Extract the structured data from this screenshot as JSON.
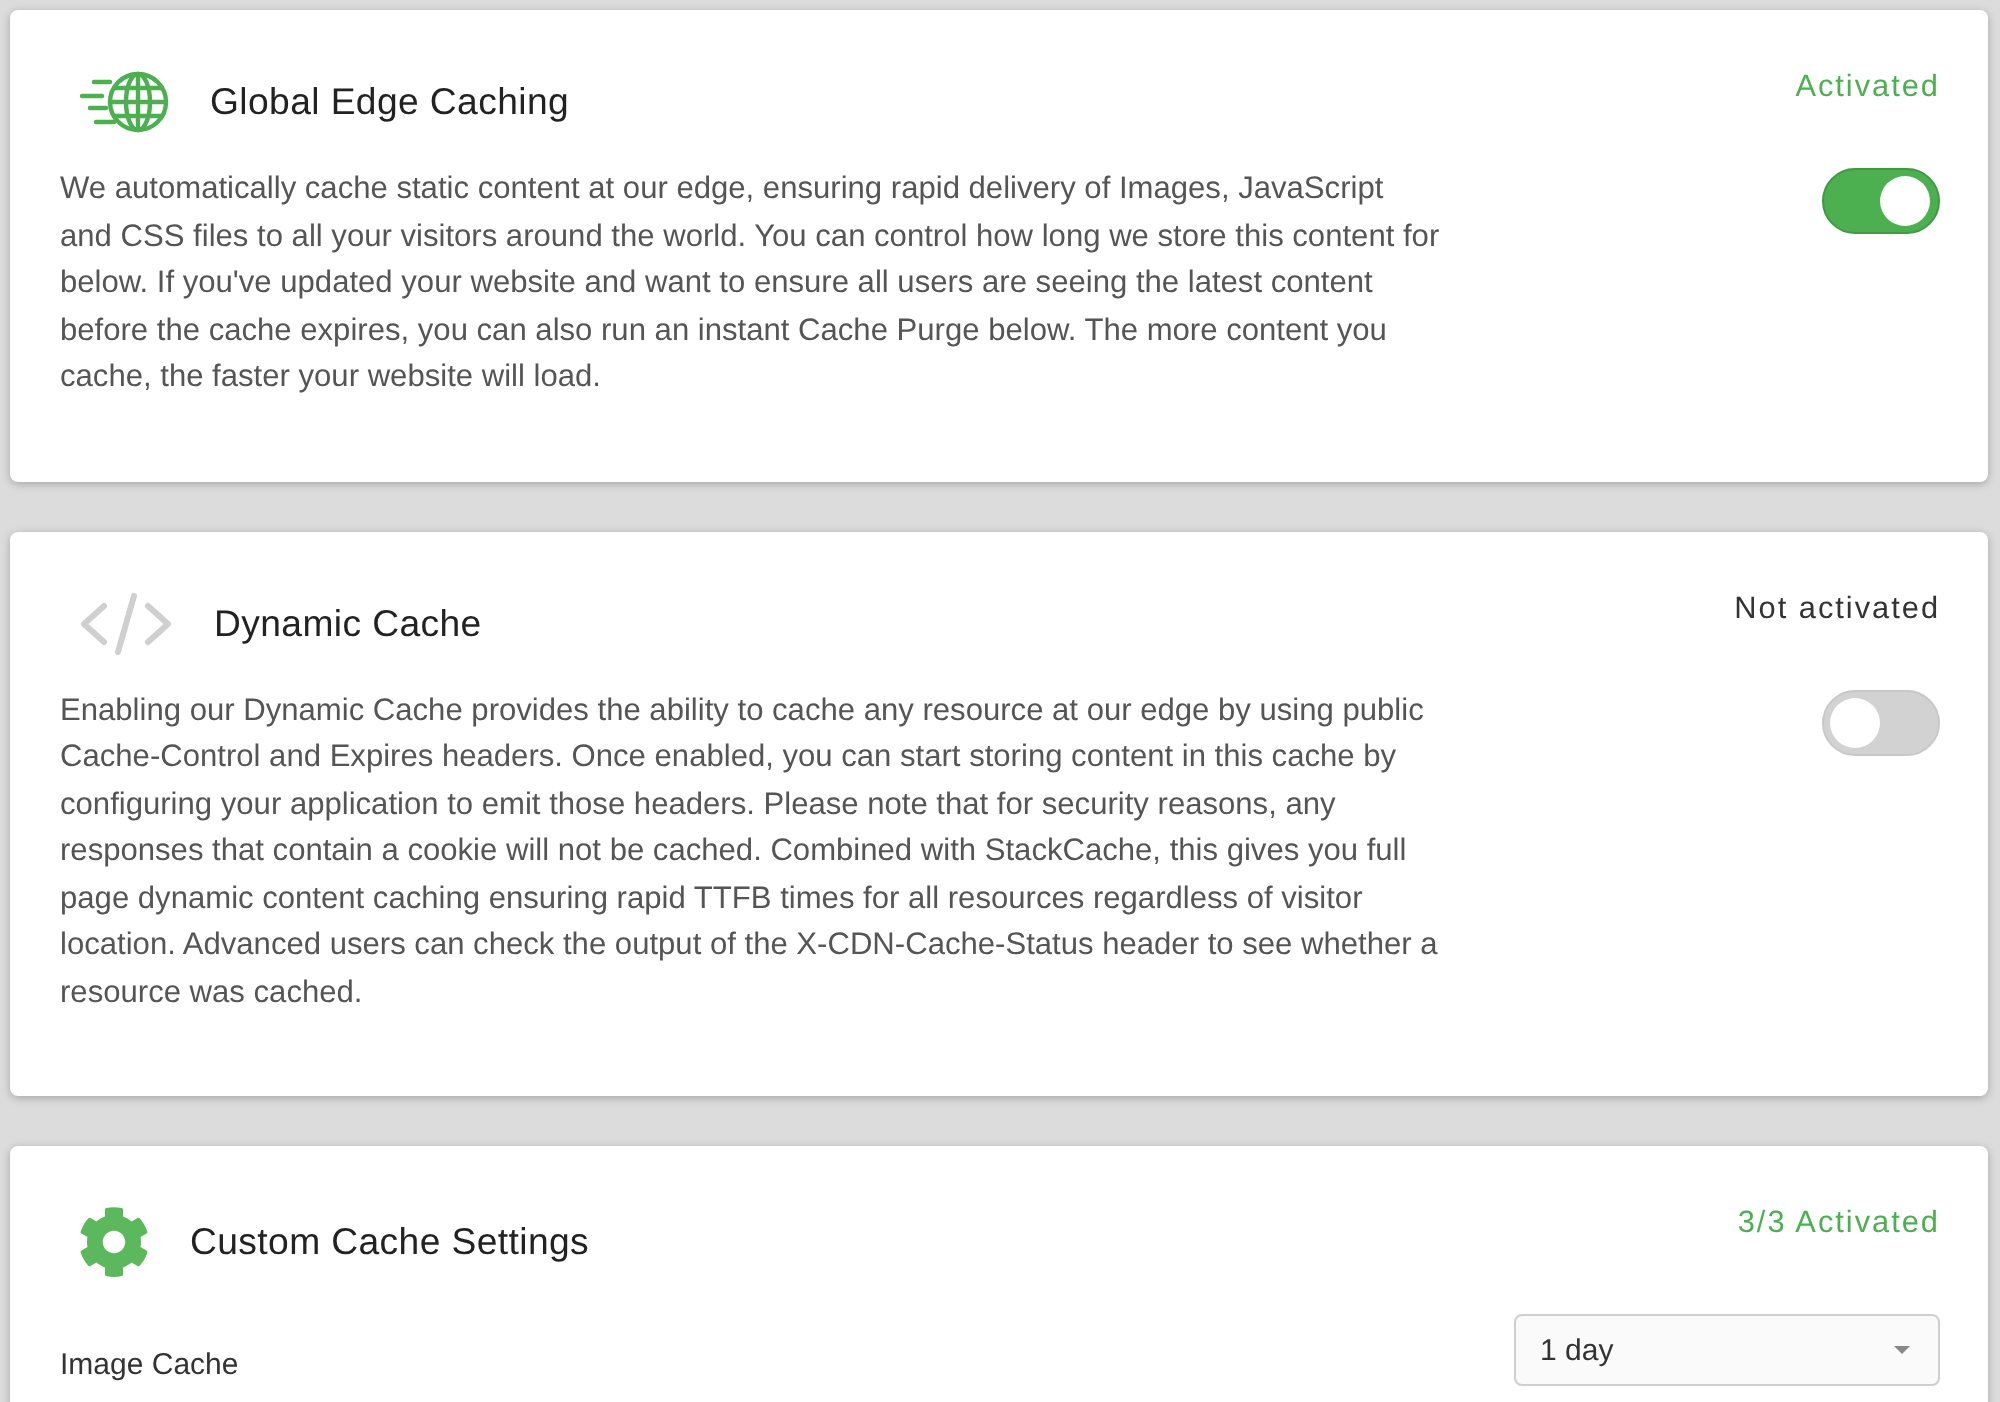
{
  "sections": [
    {
      "kind": "toggle",
      "title": "Global Edge Caching",
      "status": "Activated",
      "activated": true,
      "description": "We automatically cache static content at our edge, ensuring rapid delivery of Images, JavaScript and CSS files to all your visitors around the world. You can control how long we store this content for below. If you've updated your website and want to ensure all users are seeing the latest content before the cache expires, you can also run an instant Cache Purge below. The more content you cache, the faster your website will load."
    },
    {
      "kind": "toggle",
      "title": "Dynamic Cache",
      "status": "Not activated",
      "activated": false,
      "description": "Enabling our Dynamic Cache provides the ability to cache any resource at our edge by using public Cache-Control and Expires headers. Once enabled, you can start storing content in this cache by configuring your application to emit those headers. Please note that for security reasons, any responses that contain a cookie will not be cached. Combined with StackCache, this gives you full page dynamic content caching ensuring rapid TTFB times for all resources regardless of visitor location. Advanced users can check the output of the X-CDN-Cache-Status header to see whether a resource was cached."
    },
    {
      "kind": "settings",
      "title": "Custom Cache Settings",
      "status": "3/3 Activated",
      "activated": true,
      "settings": [
        {
          "label": "Image Cache",
          "value": "1 day"
        }
      ]
    }
  ]
}
